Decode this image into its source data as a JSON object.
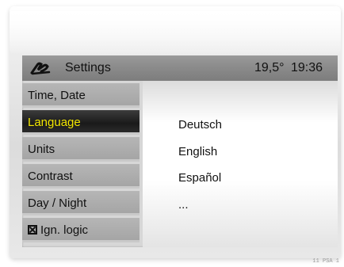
{
  "statusbar": {
    "title": "Settings",
    "temperature": "19,5°",
    "time": "19:36",
    "logo_icon": "signature-logo-icon"
  },
  "menu": {
    "items": [
      {
        "label": "Time, Date",
        "selected": false
      },
      {
        "label": "Language",
        "selected": true
      },
      {
        "label": "Units",
        "selected": false
      },
      {
        "label": "Contrast",
        "selected": false
      },
      {
        "label": "Day / Night",
        "selected": false
      },
      {
        "label": "Ign. logic",
        "selected": false,
        "checkbox": true
      }
    ],
    "selected_color": "#f2e600"
  },
  "languages": [
    "Deutsch",
    "English",
    "Español",
    "..."
  ],
  "footer_code": "11 PSA 1"
}
